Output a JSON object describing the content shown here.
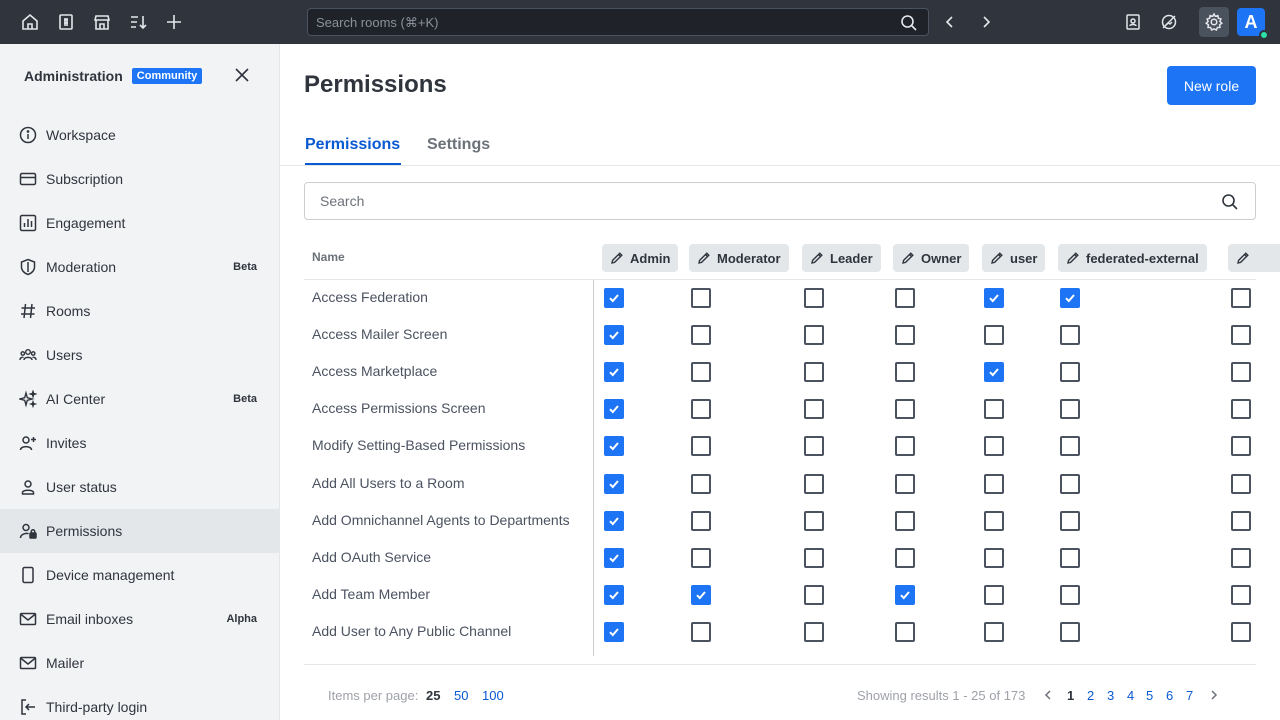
{
  "topbar": {
    "search_placeholder": "Search rooms (⌘+K)",
    "avatar_letter": "A"
  },
  "sidebar": {
    "title": "Administration",
    "badge": "Community",
    "items": [
      {
        "label": "Workspace",
        "icon": "info-circle-icon",
        "tag": ""
      },
      {
        "label": "Subscription",
        "icon": "card-icon",
        "tag": ""
      },
      {
        "label": "Engagement",
        "icon": "dashboard-icon",
        "tag": ""
      },
      {
        "label": "Moderation",
        "icon": "shield-icon",
        "tag": "Beta"
      },
      {
        "label": "Rooms",
        "icon": "hashtag-icon",
        "tag": ""
      },
      {
        "label": "Users",
        "icon": "team-icon",
        "tag": ""
      },
      {
        "label": "AI Center",
        "icon": "sparkle-icon",
        "tag": "Beta"
      },
      {
        "label": "Invites",
        "icon": "user-plus-icon",
        "tag": ""
      },
      {
        "label": "User status",
        "icon": "user-icon",
        "tag": ""
      },
      {
        "label": "Permissions",
        "icon": "user-lock-icon",
        "tag": ""
      },
      {
        "label": "Device management",
        "icon": "mobile-icon",
        "tag": ""
      },
      {
        "label": "Email inboxes",
        "icon": "mail-icon",
        "tag": "Alpha"
      },
      {
        "label": "Mailer",
        "icon": "mail-icon",
        "tag": ""
      },
      {
        "label": "Third-party login",
        "icon": "login-icon",
        "tag": ""
      }
    ]
  },
  "main": {
    "title": "Permissions",
    "new_role_label": "New role",
    "tabs": [
      "Permissions",
      "Settings"
    ],
    "search_placeholder": "Search",
    "name_header": "Name",
    "roles": [
      "Admin",
      "Moderator",
      "Leader",
      "Owner",
      "user",
      "federated-external"
    ],
    "rows": [
      {
        "name": "Access Federation",
        "checks": [
          true,
          false,
          false,
          false,
          true,
          true,
          false
        ]
      },
      {
        "name": "Access Mailer Screen",
        "checks": [
          true,
          false,
          false,
          false,
          false,
          false,
          false
        ]
      },
      {
        "name": "Access Marketplace",
        "checks": [
          true,
          false,
          false,
          false,
          true,
          false,
          false
        ]
      },
      {
        "name": "Access Permissions Screen",
        "checks": [
          true,
          false,
          false,
          false,
          false,
          false,
          false
        ]
      },
      {
        "name": "Modify Setting-Based Permissions",
        "checks": [
          true,
          false,
          false,
          false,
          false,
          false,
          false
        ]
      },
      {
        "name": "Add All Users to a Room",
        "checks": [
          true,
          false,
          false,
          false,
          false,
          false,
          false
        ]
      },
      {
        "name": "Add Omnichannel Agents to Departments",
        "checks": [
          true,
          false,
          false,
          false,
          false,
          false,
          false
        ]
      },
      {
        "name": "Add OAuth Service",
        "checks": [
          true,
          false,
          false,
          false,
          false,
          false,
          false
        ]
      },
      {
        "name": "Add Team Member",
        "checks": [
          true,
          true,
          false,
          true,
          false,
          false,
          false
        ]
      },
      {
        "name": "Add User to Any Public Channel",
        "checks": [
          true,
          false,
          false,
          false,
          false,
          false,
          false
        ]
      }
    ]
  },
  "pagination": {
    "items_per_page_label": "Items per page:",
    "options": [
      "25",
      "50",
      "100"
    ],
    "selected_option": "25",
    "showing": "Showing results 1 - 25 of 173",
    "pages": [
      "1",
      "2",
      "3",
      "4",
      "5",
      "6",
      "7"
    ],
    "current_page": "1"
  }
}
